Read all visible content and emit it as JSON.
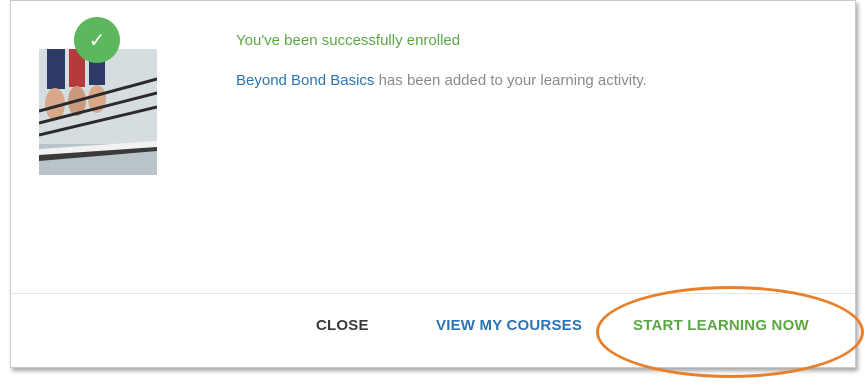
{
  "dialog": {
    "success_title": "You've been successfully enrolled",
    "course_name": "Beyond Bond Basics",
    "message_suffix": " has been added to your learning activity.",
    "check_glyph": "✓",
    "thumbnail_icon": "rowing-team-photo"
  },
  "buttons": {
    "close_label": "CLOSE",
    "view_courses_label": "VIEW MY COURSES",
    "start_learning_label": "START LEARNING NOW"
  },
  "colors": {
    "success_green": "#5aa843",
    "badge_green": "#5cb85c",
    "link_blue": "#2a74b5",
    "highlight_orange": "#e87f2a"
  }
}
